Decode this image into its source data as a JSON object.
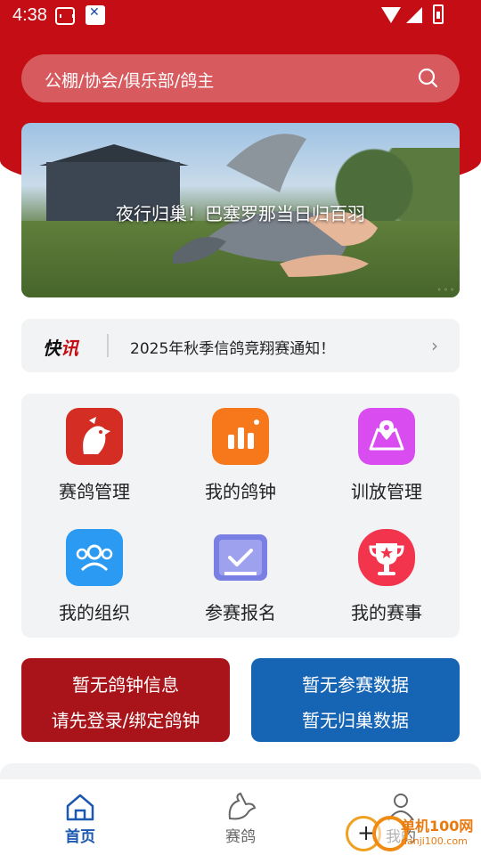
{
  "status_bar": {
    "time": "4:38"
  },
  "search": {
    "placeholder": "公棚/协会/俱乐部/鸽主"
  },
  "banner": {
    "caption": "夜行归巢！巴塞罗那当日归百羽"
  },
  "news": {
    "tag_a": "快",
    "tag_b": "讯",
    "text": "2025年秋季信鸽竞翔赛通知！",
    "arrow": "›"
  },
  "grid": {
    "items": [
      {
        "label": "赛鸽管理",
        "icon": "pigeon-logo-icon",
        "color": "#d42e24"
      },
      {
        "label": "我的鸽钟",
        "icon": "bar-chart-icon",
        "color": "#f7781b"
      },
      {
        "label": "训放管理",
        "icon": "map-pin-icon",
        "color": "#d84cf0"
      },
      {
        "label": "我的组织",
        "icon": "group-icon",
        "color": "#2a9af2"
      },
      {
        "label": "参赛报名",
        "icon": "book-check-icon",
        "color": "#7a7fe4"
      },
      {
        "label": "我的赛事",
        "icon": "trophy-icon",
        "color": "#f2344c"
      }
    ]
  },
  "cards": {
    "left": {
      "line1": "暂无鸽钟信息",
      "line2": "请先登录/绑定鸽钟",
      "color": "#a8141a"
    },
    "right": {
      "line1": "暂无参赛数据",
      "line2": "暂无归巢数据",
      "color": "#1664b4"
    }
  },
  "nav": {
    "tabs": [
      {
        "label": "首页",
        "icon": "home-icon",
        "active": true
      },
      {
        "label": "赛鸽",
        "icon": "dove-icon",
        "active": false
      },
      {
        "label": "我的",
        "icon": "user-icon",
        "active": false
      }
    ]
  },
  "watermark": {
    "site": "单机100网",
    "url": "danji100.com"
  },
  "colors": {
    "brand_red": "#c40d14",
    "nav_active": "#1c58b0"
  }
}
